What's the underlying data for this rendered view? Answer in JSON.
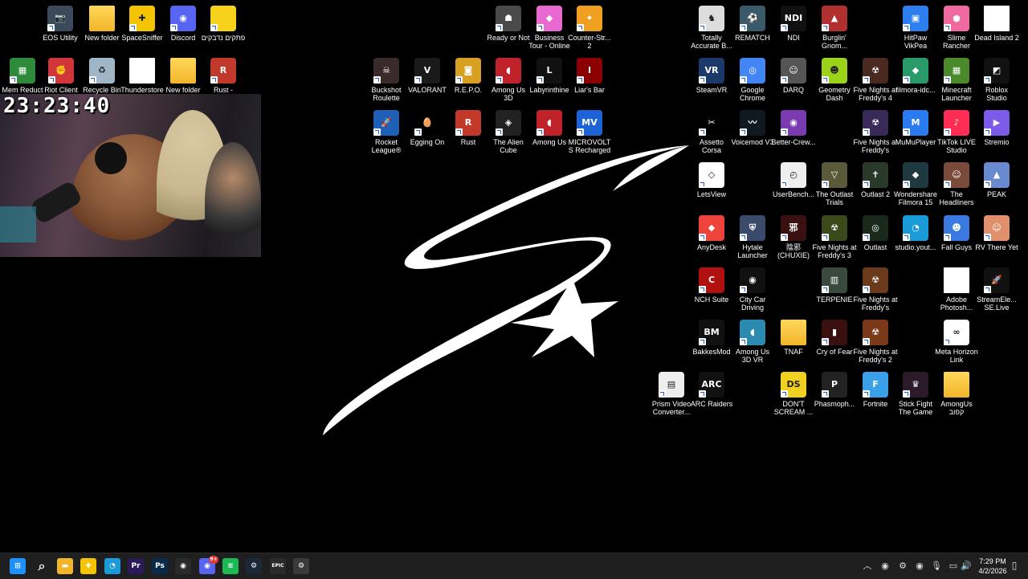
{
  "desktop_icons": [
    {
      "label": "EOS Utility",
      "icon": "camera-icon",
      "color": "#3a4a5a",
      "glyph": "📷",
      "kind": "app"
    },
    {
      "label": "New folder",
      "icon": "folder-icon",
      "color": "#f2b52a",
      "glyph": "",
      "kind": "folder"
    },
    {
      "label": "SpaceSniffer",
      "icon": "puzzle-icon",
      "color": "#f5c400",
      "glyph": "✚",
      "kind": "app"
    },
    {
      "label": "Discord",
      "icon": "discord-icon",
      "color": "#5865f2",
      "glyph": "◉",
      "kind": "app"
    },
    {
      "label": "פתקים נדבקים",
      "icon": "sticky-notes-icon",
      "color": "#f7d21c",
      "glyph": "",
      "kind": "app"
    },
    {
      "label": "Mem Reduct",
      "icon": "memory-icon",
      "color": "#2e8b3a",
      "glyph": "▦",
      "kind": "app"
    },
    {
      "label": "Riot Client",
      "icon": "riot-icon",
      "color": "#d13639",
      "glyph": "✊",
      "kind": "app"
    },
    {
      "label": "Recycle Bin",
      "icon": "recycle-bin-icon",
      "color": "#9fb6c8",
      "glyph": "♻",
      "kind": "app"
    },
    {
      "label": "Thunderstore",
      "icon": "file-icon",
      "color": "#ffffff",
      "glyph": "",
      "kind": "file"
    },
    {
      "label": "New folder",
      "icon": "folder-icon",
      "color": "#f2b52a",
      "glyph": "",
      "kind": "folder"
    },
    {
      "label": "Rust -",
      "icon": "rust-icon",
      "color": "#c0392b",
      "glyph": "R",
      "kind": "app"
    },
    {
      "label": "Ready or Not",
      "icon": "soldier-icon",
      "color": "#4a4a4a",
      "glyph": "☗",
      "kind": "app"
    },
    {
      "label": "Business Tour - Online M...",
      "icon": "business-tour-icon",
      "color": "#e86ad0",
      "glyph": "◆",
      "kind": "app"
    },
    {
      "label": "Counter-Str... 2",
      "icon": "cs2-icon",
      "color": "#f0a020",
      "glyph": "✦",
      "kind": "app"
    },
    {
      "label": "Buckshot Roulette",
      "icon": "skull-icon",
      "color": "#3a2a2a",
      "glyph": "☠",
      "kind": "app"
    },
    {
      "label": "VALORANT",
      "icon": "valorant-icon",
      "color": "#1a1a1a",
      "glyph": "V",
      "kind": "app"
    },
    {
      "label": "R.E.P.O.",
      "icon": "repo-icon",
      "color": "#d8a020",
      "glyph": "◙",
      "kind": "app"
    },
    {
      "label": "Among Us 3D",
      "icon": "among-us-3d-icon",
      "color": "#c0222a",
      "glyph": "◖",
      "kind": "app"
    },
    {
      "label": "Labyrinthine",
      "icon": "labyrinthine-icon",
      "color": "#111111",
      "glyph": "L",
      "kind": "app"
    },
    {
      "label": "Liar's Bar",
      "icon": "liars-bar-icon",
      "color": "#8b0000",
      "glyph": "I",
      "kind": "app"
    },
    {
      "label": "Rocket League®",
      "icon": "rocket-league-icon",
      "color": "#1e5fb8",
      "glyph": "🚀",
      "kind": "app"
    },
    {
      "label": "Egging On",
      "icon": "egg-icon",
      "color": "#000000",
      "glyph": "🥚",
      "kind": "app"
    },
    {
      "label": "Rust",
      "icon": "rust-icon",
      "color": "#c0392b",
      "glyph": "R",
      "kind": "app"
    },
    {
      "label": "The Alien Cube",
      "icon": "alien-cube-icon",
      "color": "#222222",
      "glyph": "◈",
      "kind": "app"
    },
    {
      "label": "Among Us",
      "icon": "among-us-icon",
      "color": "#c0222a",
      "glyph": "◖",
      "kind": "app"
    },
    {
      "label": "MICROVOLTS Recharged",
      "icon": "microvolts-icon",
      "color": "#1e63d6",
      "glyph": "MV",
      "kind": "app"
    },
    {
      "label": "Totally Accurate B...",
      "icon": "tabs-icon",
      "color": "#ddd",
      "glyph": "♞",
      "kind": "app"
    },
    {
      "label": "REMATCH",
      "icon": "rematch-icon",
      "color": "#3a5a6a",
      "glyph": "⚽",
      "kind": "app"
    },
    {
      "label": "NDI",
      "icon": "ndi-icon",
      "color": "#111111",
      "glyph": "NDI",
      "kind": "app"
    },
    {
      "label": "Burglin' Gnom...",
      "icon": "gnome-icon",
      "color": "#b03030",
      "glyph": "▲",
      "kind": "app"
    },
    {
      "label": "HitPaw VikPea",
      "icon": "hitpaw-icon",
      "color": "#2d7ff0",
      "glyph": "▣",
      "kind": "app"
    },
    {
      "label": "Slime Rancher",
      "icon": "slime-icon",
      "color": "#f06aa0",
      "glyph": "●",
      "kind": "app"
    },
    {
      "label": "Dead Island 2",
      "icon": "file-icon",
      "color": "#ffffff",
      "glyph": "",
      "kind": "file"
    },
    {
      "label": "SteamVR",
      "icon": "steamvr-icon",
      "color": "#1b3a6b",
      "glyph": "VR",
      "kind": "app"
    },
    {
      "label": "Google Chrome",
      "icon": "chrome-icon",
      "color": "#4285f4",
      "glyph": "◎",
      "kind": "app"
    },
    {
      "label": "DARQ",
      "icon": "darq-icon",
      "color": "#555555",
      "glyph": "☺",
      "kind": "app"
    },
    {
      "label": "Geometry Dash",
      "icon": "geometry-dash-icon",
      "color": "#9bd21a",
      "glyph": "☻",
      "kind": "app"
    },
    {
      "label": "Five Nights at Freddy's 4",
      "icon": "fnaf-icon",
      "color": "#4a2a20",
      "glyph": "☢",
      "kind": "app"
    },
    {
      "label": "filmora-idc...",
      "icon": "filmora-installer-icon",
      "color": "#2a9a6a",
      "glyph": "◆",
      "kind": "app"
    },
    {
      "label": "Minecraft Launcher",
      "icon": "minecraft-icon",
      "color": "#4a8a2a",
      "glyph": "▦",
      "kind": "app"
    },
    {
      "label": "Roblox Studio",
      "icon": "roblox-icon",
      "color": "#111111",
      "glyph": "◩",
      "kind": "app"
    },
    {
      "label": "Assetto Corsa",
      "icon": "assetto-corsa-icon",
      "color": "#000000",
      "glyph": "✂",
      "kind": "app"
    },
    {
      "label": "Voicemod V3",
      "icon": "voicemod-icon",
      "color": "#101820",
      "glyph": "〰",
      "kind": "app"
    },
    {
      "label": "Better-Crew...",
      "icon": "better-crewlink-icon",
      "color": "#7a3ab0",
      "glyph": "◉",
      "kind": "app"
    },
    {
      "label": "Five Nights at Freddy's Sis...",
      "icon": "fnaf-sl-icon",
      "color": "#3a2a5a",
      "glyph": "☢",
      "kind": "app"
    },
    {
      "label": "MuMuPlayer",
      "icon": "mumu-icon",
      "color": "#2a7af0",
      "glyph": "M",
      "kind": "app"
    },
    {
      "label": "TikTok LIVE Studio",
      "icon": "tiktok-icon",
      "color": "#ff2d55",
      "glyph": "♪",
      "kind": "app"
    },
    {
      "label": "Stremio",
      "icon": "stremio-icon",
      "color": "#7b5be8",
      "glyph": "▶",
      "kind": "app"
    },
    {
      "label": "LetsView",
      "icon": "letsview-icon",
      "color": "#ffffff",
      "glyph": "◇",
      "kind": "app"
    },
    {
      "label": "UserBench...",
      "icon": "userbenchmark-icon",
      "color": "#eeeeee",
      "glyph": "◴",
      "kind": "app"
    },
    {
      "label": "The Outlast Trials",
      "icon": "outlast-trials-icon",
      "color": "#5a5a3a",
      "glyph": "▽",
      "kind": "app"
    },
    {
      "label": "Outlast 2",
      "icon": "outlast2-icon",
      "color": "#2a3a2a",
      "glyph": "✝",
      "kind": "app"
    },
    {
      "label": "Wondershare Filmora 15",
      "icon": "filmora-icon",
      "color": "#1e3a40",
      "glyph": "◆",
      "kind": "app"
    },
    {
      "label": "The Headliners",
      "icon": "headliners-icon",
      "color": "#7a4a3a",
      "glyph": "☺",
      "kind": "app"
    },
    {
      "label": "PEAK",
      "icon": "peak-icon",
      "color": "#6a8ad0",
      "glyph": "▲",
      "kind": "app"
    },
    {
      "label": "AnyDesk",
      "icon": "anydesk-icon",
      "color": "#ef443b",
      "glyph": "◆",
      "kind": "app"
    },
    {
      "label": "Hytale Launcher",
      "icon": "hytale-icon",
      "color": "#3a4a6a",
      "glyph": "⛨",
      "kind": "app"
    },
    {
      "label": "陰邪 (CHUXIE)",
      "icon": "chuxie-icon",
      "color": "#3a1010",
      "glyph": "邪",
      "kind": "app"
    },
    {
      "label": "Five Nights at Freddy's 3",
      "icon": "fnaf3-icon",
      "color": "#3a4a1a",
      "glyph": "☢",
      "kind": "app"
    },
    {
      "label": "Outlast",
      "icon": "outlast-icon",
      "color": "#1a2a1a",
      "glyph": "◎",
      "kind": "app"
    },
    {
      "label": "studio.yout...",
      "icon": "edge-icon",
      "color": "#1a9ad6",
      "glyph": "◔",
      "kind": "app"
    },
    {
      "label": "Fall Guys",
      "icon": "fall-guys-icon",
      "color": "#3a7ae0",
      "glyph": "☻",
      "kind": "app"
    },
    {
      "label": "RV There Yet",
      "icon": "rv-there-yet-icon",
      "color": "#e0906a",
      "glyph": "☺",
      "kind": "app"
    },
    {
      "label": "NCH Suite",
      "icon": "nch-icon",
      "color": "#b01010",
      "glyph": "C",
      "kind": "app"
    },
    {
      "label": "City Car Driving",
      "icon": "city-car-driving-icon",
      "color": "#111111",
      "glyph": "◉",
      "kind": "app"
    },
    {
      "label": "TERPENIE",
      "icon": "terpenie-icon",
      "color": "#3a4a3a",
      "glyph": "▥",
      "kind": "app"
    },
    {
      "label": "Five Nights at Freddy's",
      "icon": "fnaf1-icon",
      "color": "#6a3a1a",
      "glyph": "☢",
      "kind": "app"
    },
    {
      "label": "Adobe Photosh...",
      "icon": "photoshop-file-icon",
      "color": "#ffffff",
      "glyph": "",
      "kind": "file"
    },
    {
      "label": "StreamEle... SE.Live",
      "icon": "streamelements-icon",
      "color": "#111111",
      "glyph": "🚀",
      "kind": "app"
    },
    {
      "label": "BakkesMod",
      "icon": "bakkesmod-icon",
      "color": "#111111",
      "glyph": "BM",
      "kind": "app"
    },
    {
      "label": "Among Us 3D VR",
      "icon": "among-us-vr-icon",
      "color": "#2a8ab0",
      "glyph": "◖",
      "kind": "app"
    },
    {
      "label": "TNAF",
      "icon": "folder-icon",
      "color": "#f2b52a",
      "glyph": "",
      "kind": "folder"
    },
    {
      "label": "Cry of Fear",
      "icon": "cry-of-fear-icon",
      "color": "#3a1010",
      "glyph": "▮",
      "kind": "app"
    },
    {
      "label": "Five Nights at Freddy's 2",
      "icon": "fnaf2-icon",
      "color": "#7a3a1a",
      "glyph": "☢",
      "kind": "app"
    },
    {
      "label": "Meta Horizon Link",
      "icon": "meta-icon",
      "color": "#ffffff",
      "glyph": "∞",
      "kind": "app"
    },
    {
      "label": "Prism Video Converter...",
      "icon": "prism-icon",
      "color": "#eeeeee",
      "glyph": "▤",
      "kind": "app"
    },
    {
      "label": "ARC Raiders",
      "icon": "arc-raiders-icon",
      "color": "#111111",
      "glyph": "ARC",
      "kind": "app"
    },
    {
      "label": "DON'T SCREAM ...",
      "icon": "dont-scream-icon",
      "color": "#f0d020",
      "glyph": "DS",
      "kind": "app"
    },
    {
      "label": "Phasmoph...",
      "icon": "phasmophobia-icon",
      "color": "#222222",
      "glyph": "P",
      "kind": "app"
    },
    {
      "label": "Fortnite",
      "icon": "fortnite-icon",
      "color": "#3aa0e8",
      "glyph": "F",
      "kind": "app"
    },
    {
      "label": "Stick Fight The Game",
      "icon": "stick-fight-icon",
      "color": "#2a1a2a",
      "glyph": "♛",
      "kind": "app"
    },
    {
      "label": "AmongUs קפוב",
      "icon": "folder-icon",
      "color": "#f2b52a",
      "glyph": "",
      "kind": "folder"
    }
  ],
  "webcam": {
    "clock_text": "23:23:40"
  },
  "taskbar": {
    "items": [
      {
        "icon": "windows-start-icon",
        "color": "#1e90ff",
        "glyph": "⊞"
      },
      {
        "icon": "search-icon",
        "color": "transparent",
        "glyph": "⌕"
      },
      {
        "icon": "file-explorer-icon",
        "color": "#f2b52a",
        "glyph": "▬"
      },
      {
        "icon": "spacesniffer-icon",
        "color": "#f5c400",
        "glyph": "✚"
      },
      {
        "icon": "edge-icon",
        "color": "#1a9ad6",
        "glyph": "◔"
      },
      {
        "icon": "premiere-pro-icon",
        "color": "#2a1a5a",
        "glyph": "Pr"
      },
      {
        "icon": "photoshop-icon",
        "color": "#0a2a4a",
        "glyph": "Ps"
      },
      {
        "icon": "obs-icon",
        "color": "#2a2a2a",
        "glyph": "◉"
      },
      {
        "icon": "discord-icon",
        "color": "#5865f2",
        "glyph": "◉"
      },
      {
        "icon": "spotify-icon",
        "color": "#1db954",
        "glyph": "≋"
      },
      {
        "icon": "steam-icon",
        "color": "#1b2838",
        "glyph": "⚙"
      },
      {
        "icon": "epic-games-icon",
        "color": "#2a2a2a",
        "glyph": "EPIC"
      },
      {
        "icon": "settings-icon",
        "color": "#3a3a3a",
        "glyph": "⚙"
      }
    ],
    "discord_badge": "9+",
    "tray": [
      {
        "icon": "chevron-up-icon",
        "glyph": "︿"
      },
      {
        "icon": "riot-tray-icon",
        "glyph": "◉"
      },
      {
        "icon": "steam-tray-icon",
        "glyph": "⚙"
      },
      {
        "icon": "discord-tray-icon",
        "glyph": "◉"
      },
      {
        "icon": "microphone-icon",
        "glyph": "🎙"
      },
      {
        "icon": "network-icon",
        "glyph": "▭"
      },
      {
        "icon": "volume-icon",
        "glyph": "🔊"
      }
    ],
    "time": "7:29 PM",
    "date": "4/2/2026",
    "notification_glyph": "▯"
  }
}
